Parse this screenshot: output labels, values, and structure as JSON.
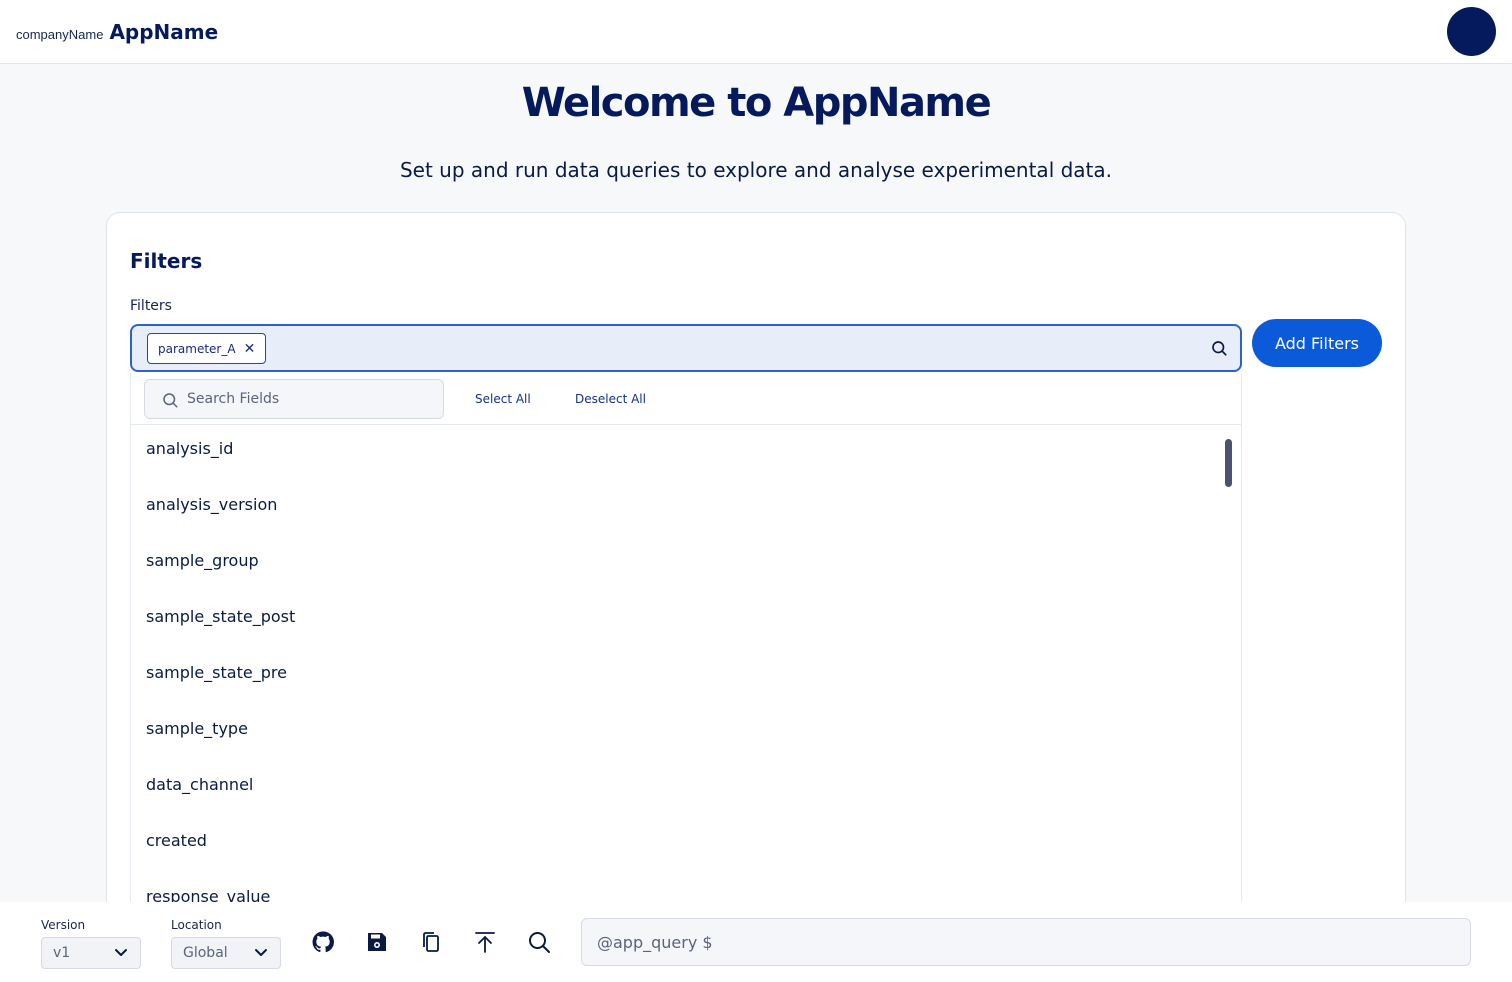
{
  "header": {
    "company_name": "companyName",
    "app_name": "AppName"
  },
  "page": {
    "title": "Welcome to AppName",
    "subtitle": "Set up and run data queries to explore and analyse experimental data."
  },
  "filters": {
    "section_title": "Filters",
    "field_label": "Filters",
    "chips": [
      "parameter_A"
    ],
    "add_button_label": "Add Filters",
    "dropdown": {
      "search_placeholder": "Search Fields",
      "select_all_label": "Select All",
      "deselect_all_label": "Deselect All",
      "fields": [
        "analysis_id",
        "analysis_version",
        "sample_group",
        "sample_state_post",
        "sample_state_pre",
        "sample_type",
        "data_channel",
        "created",
        "response_value"
      ]
    }
  },
  "footer": {
    "version_label": "Version",
    "version_value": "v1",
    "location_label": "Location",
    "location_value": "Global",
    "toolbar_icons": [
      "github-icon",
      "save-icon",
      "copy-icon",
      "upload-icon",
      "search-icon"
    ],
    "query_placeholder": "@app_query $"
  },
  "colors": {
    "brand_navy": "#051a5c",
    "primary_blue": "#0b5ad9",
    "input_focus_border": "#2e62c9",
    "input_fill": "#e7eef9"
  }
}
